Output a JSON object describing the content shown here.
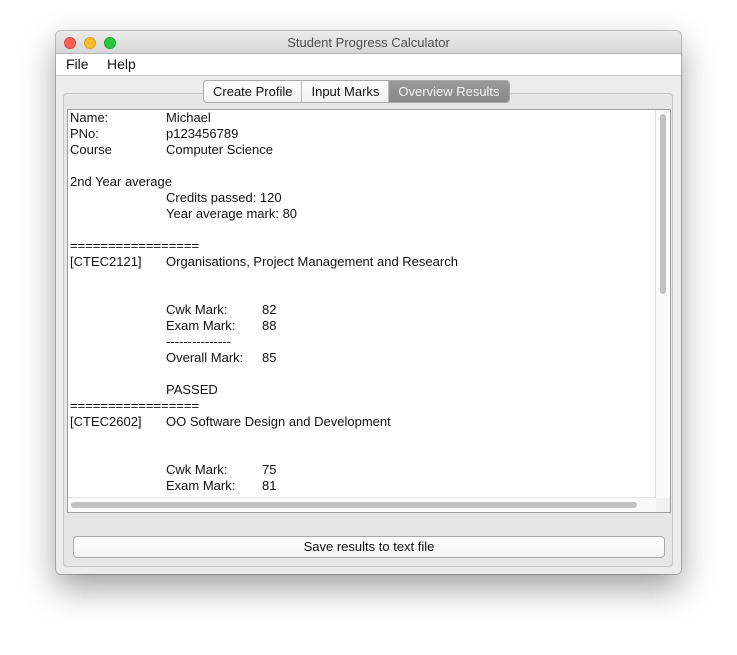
{
  "window": {
    "title": "Student Progress Calculator"
  },
  "menubar": {
    "items": [
      {
        "label": "File"
      },
      {
        "label": "Help"
      }
    ]
  },
  "tabs": [
    {
      "label": "Create Profile",
      "active": false
    },
    {
      "label": "Input Marks",
      "active": false
    },
    {
      "label": "Overview Results",
      "active": true
    }
  ],
  "results": {
    "text": "Name:\t\tMichael\nPNo:\t\tp123456789\nCourse\t\tComputer Science\n\n2nd Year average\n\t\tCredits passed: 120\n\t\tYear average mark: 80\n\n=================\n[CTEC2121]\tOrganisations, Project Management and Research\n\n\n\t\tCwk Mark:\t82\n\t\tExam Mark:\t88\n\t\t---------------\n\t\tOverall Mark:\t85\n\n\t\tPASSED\n=================\n[CTEC2602]\tOO Software Design and Development\n\n\n\t\tCwk Mark:\t75\n\t\tExam Mark:\t81"
  },
  "actions": {
    "save_label": "Save results to text file"
  },
  "colors": {
    "active_tab": "#8f8f8f",
    "window_bg": "#ececec",
    "close": "#fc5f57",
    "minimize": "#fdbc2e",
    "zoom": "#28c840"
  }
}
